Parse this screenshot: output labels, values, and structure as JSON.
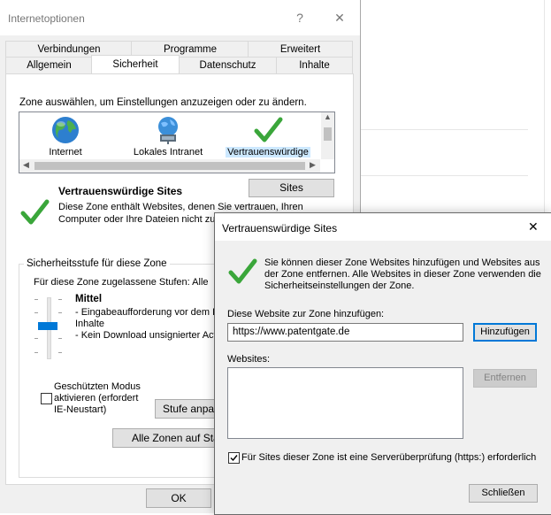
{
  "main_dialog": {
    "title": "Internetoptionen",
    "help": "?",
    "close": "✕",
    "tabs_row1": [
      "Verbindungen",
      "Programme",
      "Erweitert"
    ],
    "tabs_row2": [
      "Allgemein",
      "Sicherheit",
      "Datenschutz",
      "Inhalte"
    ],
    "active_tab": "Sicherheit",
    "zone_prompt": "Zone auswählen, um Einstellungen anzuzeigen oder zu ändern.",
    "zones": [
      {
        "label": "Internet",
        "icon": "globe-icon"
      },
      {
        "label": "Lokales Intranet",
        "icon": "intranet-icon"
      },
      {
        "label": "Vertrauenswürdige",
        "icon": "check-icon"
      }
    ],
    "selected_zone": "Vertrauenswürdige",
    "sites_button": "Sites",
    "zone_title": "Vertrauenswürdige Sites",
    "zone_desc_line1": "Diese Zone enthält Websites, denen Sie vertrauen, Ihren",
    "zone_desc_line2": "Computer oder Ihre Dateien nicht zu",
    "security_group_title": "Sicherheitsstufe für diese Zone",
    "allowed_levels": "Für diese Zone zugelassene Stufen: Alle",
    "level_name": "Mittel",
    "level_desc_line1": "- Eingabeaufforderung vor dem D",
    "level_desc_line2": "Inhalte",
    "level_desc_line3": "- Kein Download unsignierter Acti",
    "protected_mode_line1": "Geschützten Modus",
    "protected_mode_line2": "aktivieren (erfordert",
    "protected_mode_line3": "IE-Neustart)",
    "custom_level_button": "Stufe anpass",
    "default_all_button": "Alle Zonen auf Stan",
    "ok_button": "OK"
  },
  "trusted_dialog": {
    "title": "Vertrauenswürdige Sites",
    "close": "✕",
    "info_line1": "Sie können dieser Zone Websites hinzufügen und Websites aus",
    "info_line2": "der Zone entfernen. Alle Websites in dieser Zone verwenden die",
    "info_line3": "Sicherheitseinstellungen der Zone.",
    "add_label": "Diese Website zur Zone hinzufügen:",
    "add_value": "https://www.patentgate.de",
    "add_button": "Hinzufügen",
    "websites_label": "Websites:",
    "websites": [],
    "remove_button": "Entfernen",
    "https_checkbox_label": "Für Sites dieser Zone ist eine Serverüberprüfung (https:) erforderlich",
    "https_checked": true,
    "close_button": "Schließen"
  }
}
